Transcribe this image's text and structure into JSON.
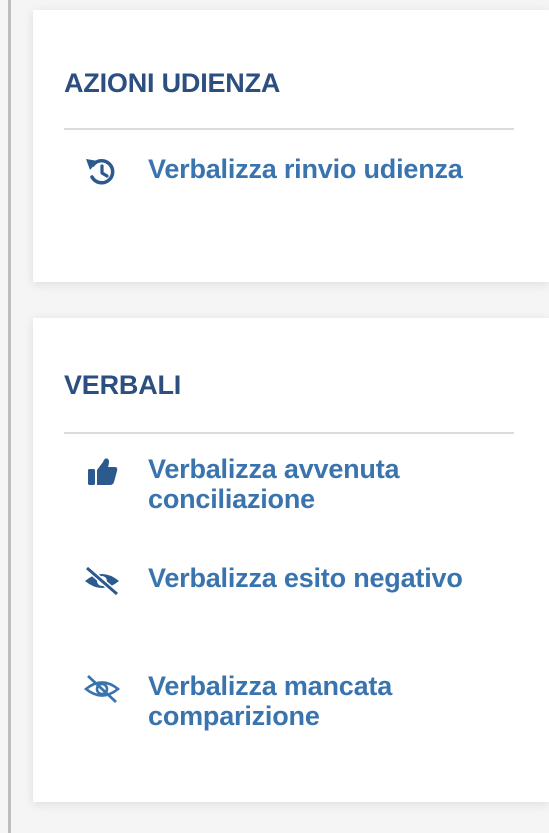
{
  "colors": {
    "title": "#2c4f80",
    "link": "#3a74ae",
    "divider": "#dcdcdc",
    "card": "#ffffff",
    "background": "#f5f5f5"
  },
  "azioni_udienza": {
    "title": "AZIONI UDIENZA",
    "actions": [
      {
        "icon": "history-icon",
        "label": "Verbalizza rinvio udienza"
      }
    ]
  },
  "verbali": {
    "title": "VERBALI",
    "actions": [
      {
        "icon": "thumbs-up-icon",
        "label": "Verbalizza avvenuta conciliazione"
      },
      {
        "icon": "eye-slash-solid-icon",
        "label": "Verbalizza esito negativo"
      },
      {
        "icon": "eye-slash-outline-icon",
        "label": "Verbalizza mancata comparizione"
      }
    ]
  }
}
